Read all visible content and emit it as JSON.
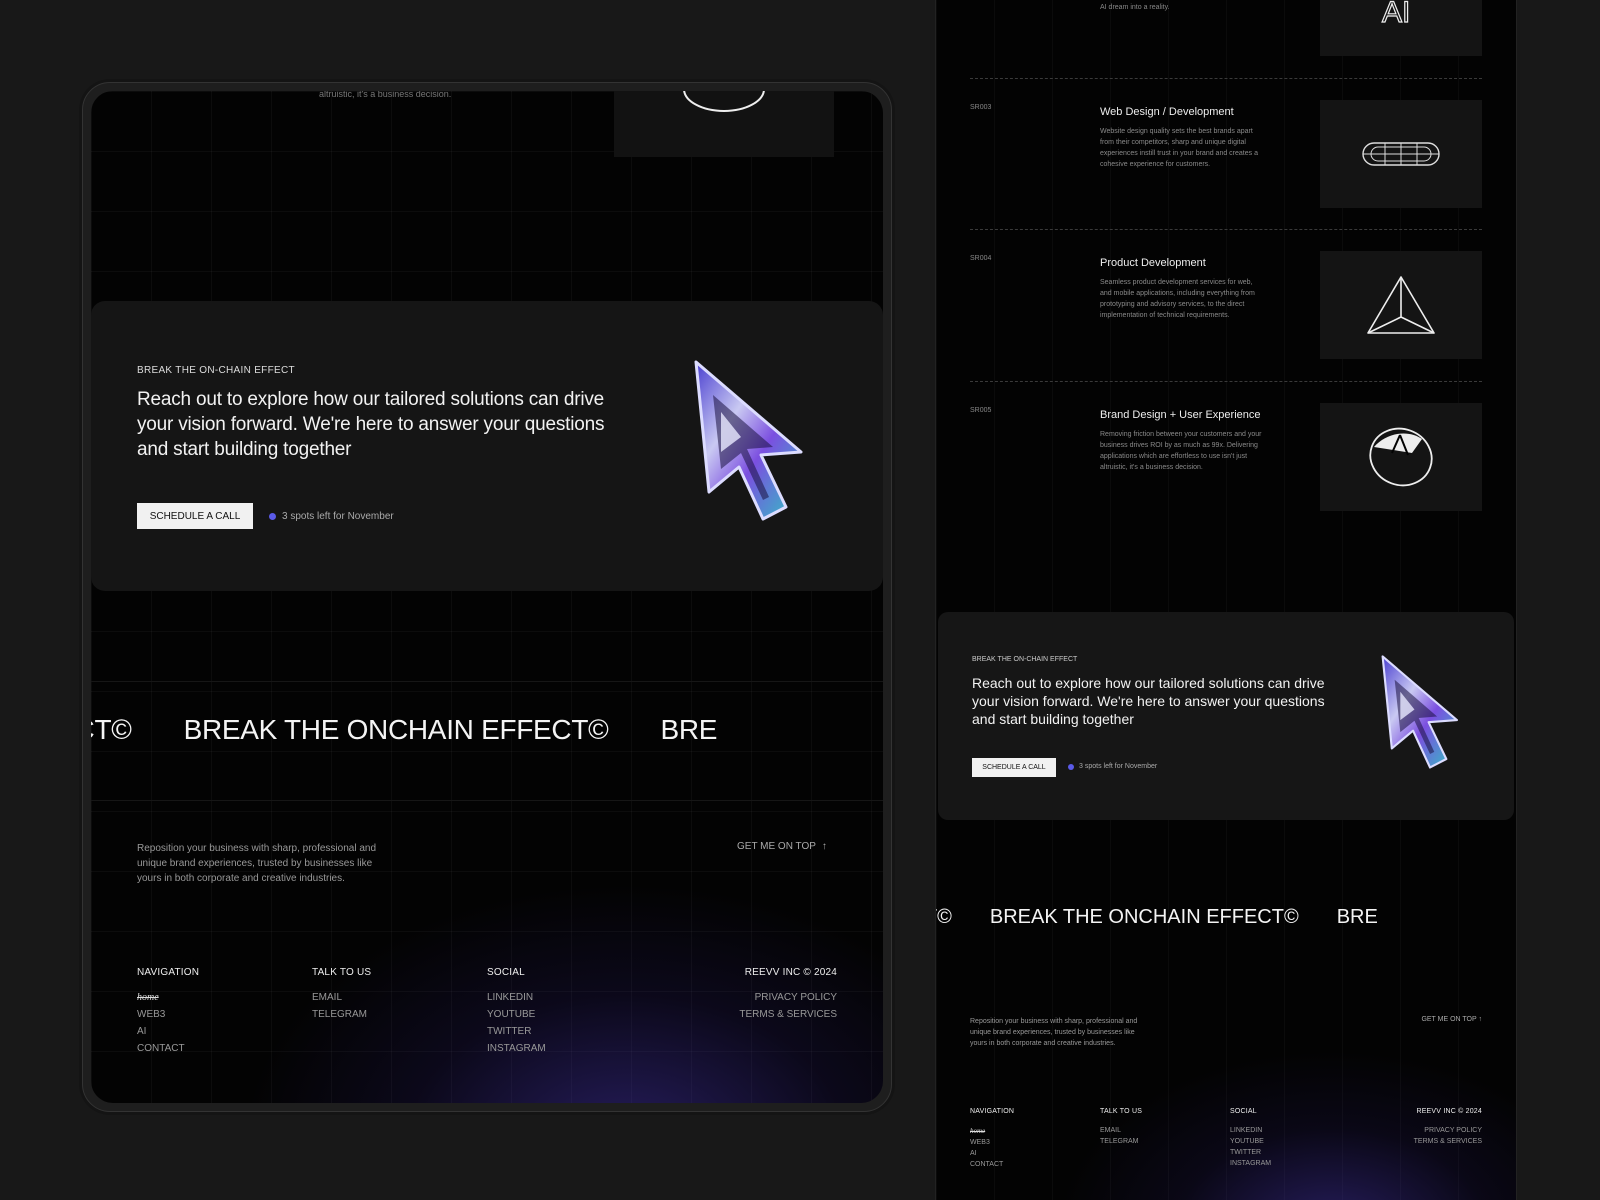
{
  "tablet": {
    "top_text": "altruistic, it's a business decision.",
    "cta": {
      "eyebrow": "BREAK THE ON-CHAIN EFFECT",
      "headline": "Reach out to explore how our tailored solutions can drive your vision forward. We're here to answer your questions and start building together",
      "button": "SCHEDULE A CALL",
      "spots": "3 spots left for November"
    },
    "marquee": [
      "HAIN EFFECT©",
      "BREAK THE ONCHAIN EFFECT©",
      "BRE"
    ],
    "footer": {
      "description": "Reposition your business with sharp, professional and unique brand experiences, trusted by businesses like yours in both corporate and creative industries.",
      "get_top": "GET ME ON TOP",
      "navigation": {
        "title": "NAVIGATION",
        "links": [
          "home",
          "WEB3",
          "AI",
          "CONTACT"
        ]
      },
      "talk": {
        "title": "TALK TO US",
        "links": [
          "EMAIL",
          "TELEGRAM"
        ]
      },
      "social": {
        "title": "SOCIAL",
        "links": [
          "LINKEDIN",
          "YOUTUBE",
          "TWITTER",
          "INSTAGRAM"
        ]
      },
      "legal": {
        "title": "REEVV INC © 2024",
        "links": [
          "PRIVACY POLICY",
          "TERMS & SERVICES"
        ]
      }
    }
  },
  "phone": {
    "top_text": "AI dream into a reality.",
    "services": [
      {
        "code": "SR003",
        "title": "Web Design / Development",
        "desc": "Website design quality sets the best brands apart from their competitors, sharp and unique digital experiences instill trust in your brand and creates a cohesive experience for customers."
      },
      {
        "code": "SR004",
        "title": "Product Development",
        "desc": "Seamless product development services for web, and mobile applications, including everything from prototyping and advisory services, to the direct implementation of technical requirements."
      },
      {
        "code": "SR005",
        "title": "Brand Design + User Experience",
        "desc": "Removing friction between your customers and your business drives ROI by as much as 99x. Delivering applications which are effortless to use isn't just altruistic, it's a business decision."
      }
    ],
    "cta": {
      "eyebrow": "BREAK THE ON-CHAIN EFFECT",
      "headline": "Reach out to explore how our tailored solutions can drive your vision forward. We're here to answer your questions and start building together",
      "button": "SCHEDULE A CALL",
      "spots": "3 spots left for November"
    },
    "marquee": [
      "HAIN EFFECT©",
      "BREAK THE ONCHAIN EFFECT©",
      "BRE"
    ],
    "footer": {
      "description": "Reposition your business with sharp, professional and unique brand experiences, trusted by businesses like yours in both corporate and creative industries.",
      "get_top": "GET ME ON TOP ↑",
      "navigation": {
        "title": "NAVIGATION",
        "links": [
          "home",
          "WEB3",
          "AI",
          "CONTACT"
        ]
      },
      "talk": {
        "title": "TALK TO US",
        "links": [
          "EMAIL",
          "TELEGRAM"
        ]
      },
      "social": {
        "title": "SOCIAL",
        "links": [
          "LINKEDIN",
          "YOUTUBE",
          "TWITTER",
          "INSTAGRAM"
        ]
      },
      "legal": {
        "title": "REEVV INC © 2024",
        "links": [
          "PRIVACY POLICY",
          "TERMS & SERVICES"
        ]
      }
    }
  },
  "colors": {
    "accent": "#5a5ae8",
    "background": "#181818",
    "screen": "#030303"
  }
}
